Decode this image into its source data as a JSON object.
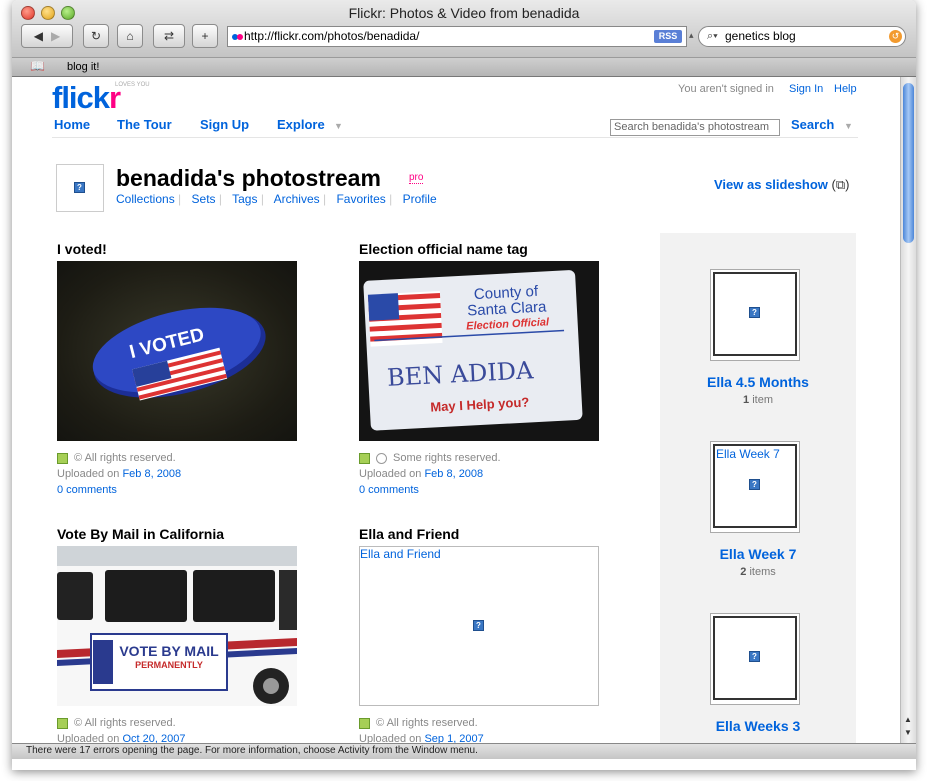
{
  "window": {
    "title": "Flickr: Photos & Video from benadida",
    "address": "http://flickr.com/photos/benadida/",
    "rss_label": "RSS",
    "search_query": "genetics blog",
    "bookmark": "blog it!",
    "status": "There were 17 errors opening the page. For more information, choose Activity from the Window menu."
  },
  "header": {
    "logo_flick": "flick",
    "logo_r": "r",
    "tagline": "LOVES YOU",
    "signed_out_text": "You aren't signed in",
    "sign_in": "Sign In",
    "help": "Help",
    "nav": [
      "Home",
      "The Tour",
      "Sign Up",
      "Explore"
    ],
    "search_placeholder": "Search benadida's photostream",
    "search_button": "Search"
  },
  "profile": {
    "title": "benadida's photostream",
    "pro_badge": "pro",
    "links": [
      "Collections",
      "Sets",
      "Tags",
      "Archives",
      "Favorites",
      "Profile"
    ],
    "slideshow": "View as slideshow"
  },
  "photos": [
    {
      "title": "I voted!",
      "rights": "All rights reserved.",
      "uploaded_prefix": "Uploaded on",
      "date": "Feb 8, 2008",
      "comments": "0 comments"
    },
    {
      "title": "Election official name tag",
      "rights": "Some rights reserved.",
      "uploaded_prefix": "Uploaded on",
      "date": "Feb 8, 2008",
      "comments": "0 comments",
      "tag_county": "County of",
      "tag_county2": "Santa Clara",
      "tag_role": "Election Official",
      "tag_name": "BEN ADIDA",
      "tag_help": "May I Help you?"
    },
    {
      "title": "Vote By Mail in California",
      "rights": "All rights reserved.",
      "uploaded_prefix": "Uploaded on",
      "date": "Oct 20, 2007",
      "banner": "VOTE BY MAIL",
      "banner2": "PERMANENTLY"
    },
    {
      "title": "Ella and Friend",
      "alt": "Ella and Friend",
      "rights": "All rights reserved.",
      "uploaded_prefix": "Uploaded on",
      "date": "Sep 1, 2007"
    }
  ],
  "sets": [
    {
      "title": "Ella 4.5 Months",
      "count": "1",
      "count_label": "item",
      "alt": ""
    },
    {
      "title": "Ella Week 7",
      "count": "2",
      "count_label": "items",
      "alt": "Ella Week 7"
    },
    {
      "title": "Ella Weeks 3",
      "count": "",
      "count_label": "",
      "alt": ""
    }
  ]
}
